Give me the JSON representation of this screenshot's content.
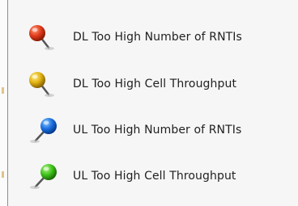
{
  "legend": {
    "items": [
      {
        "label": "DL Too High Number of RNTIs",
        "color": "#e03b1a",
        "highlight": "#ff9a7a",
        "icon": "red-pushpin-icon"
      },
      {
        "label": "DL Too High Cell Throughput",
        "color": "#e0b010",
        "highlight": "#fff08a",
        "icon": "yellow-pushpin-icon"
      },
      {
        "label": "UL Too High Number of RNTIs",
        "color": "#1a6fe0",
        "highlight": "#8ac8ff",
        "icon": "blue-pushpin-icon"
      },
      {
        "label": "UL Too High Cell Throughput",
        "color": "#3cc21a",
        "highlight": "#b6f58a",
        "icon": "green-pushpin-icon"
      }
    ]
  }
}
